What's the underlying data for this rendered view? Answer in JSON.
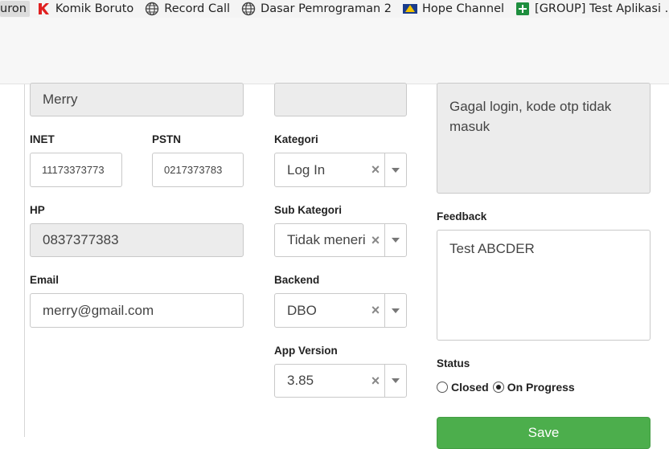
{
  "bookmarks": [
    {
      "label": "uron",
      "icon": "none"
    },
    {
      "label": "Komik Boruto",
      "icon": "k-logo-icon"
    },
    {
      "label": "Record Call",
      "icon": "globe-icon"
    },
    {
      "label": "Dasar Pemrograman 2",
      "icon": "globe-icon"
    },
    {
      "label": "Hope Channel",
      "icon": "hope-logo-icon"
    },
    {
      "label": "[GROUP] Test Aplikasi ...",
      "icon": "sheets-icon"
    }
  ],
  "form": {
    "name_value": "Merry",
    "inet_label": "INET",
    "inet_value": "11173373773",
    "pstn_label": "PSTN",
    "pstn_value": "0217373783",
    "hp_label": "HP",
    "hp_value": "0837377383",
    "email_label": "Email",
    "email_value": "merry@gmail.com",
    "kategori_label": "Kategori",
    "kategori_value": "Log In",
    "sub_kategori_label": "Sub Kategori",
    "sub_kategori_value": "Tidak meneri",
    "backend_label": "Backend",
    "backend_value": "DBO",
    "app_version_label": "App Version",
    "app_version_value": "3.85",
    "keluhan_value": "Gagal login, kode otp tidak masuk",
    "feedback_label": "Feedback",
    "feedback_value": "Test ABCDER",
    "status_label": "Status",
    "status_options": [
      "Closed",
      "On Progress"
    ],
    "status_selected": "On Progress",
    "save_label": "Save",
    "clear_glyph": "×"
  },
  "colors": {
    "save_button": "#4cae4c",
    "disabled_field": "#ececec"
  }
}
